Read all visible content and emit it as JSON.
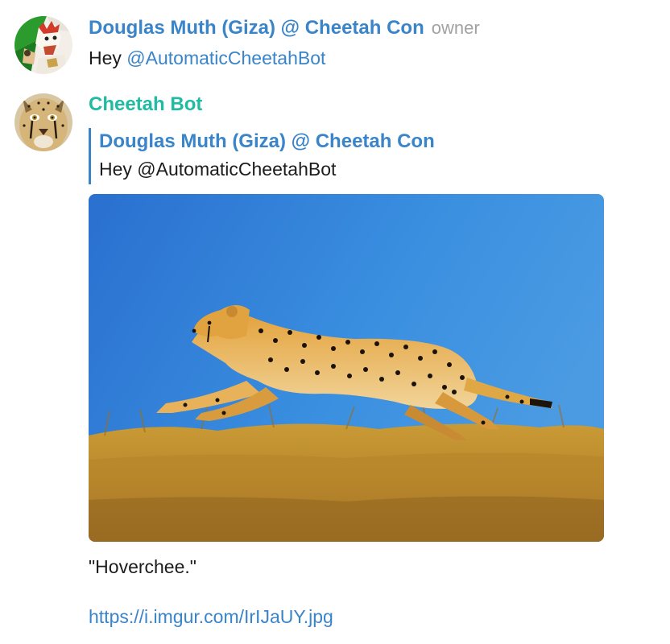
{
  "messages": [
    {
      "sender": "Douglas Muth (Giza) @ Cheetah Con",
      "role": "owner",
      "text_prefix": "Hey ",
      "mention": "@AutomaticCheetahBot"
    },
    {
      "sender": "Cheetah Bot",
      "reply": {
        "sender": "Douglas Muth (Giza) @ Cheetah Con",
        "text": "Hey @AutomaticCheetahBot"
      },
      "caption": "\"Hoverchee.\"",
      "link": "https://i.imgur.com/IrIJaUY.jpg"
    }
  ],
  "colors": {
    "accent_blue": "#3a84c9",
    "bot_name_teal": "#1fbba3",
    "role_gray": "#a2a2a2",
    "sky": "#2f7ed8",
    "grass": "#c7952e"
  }
}
